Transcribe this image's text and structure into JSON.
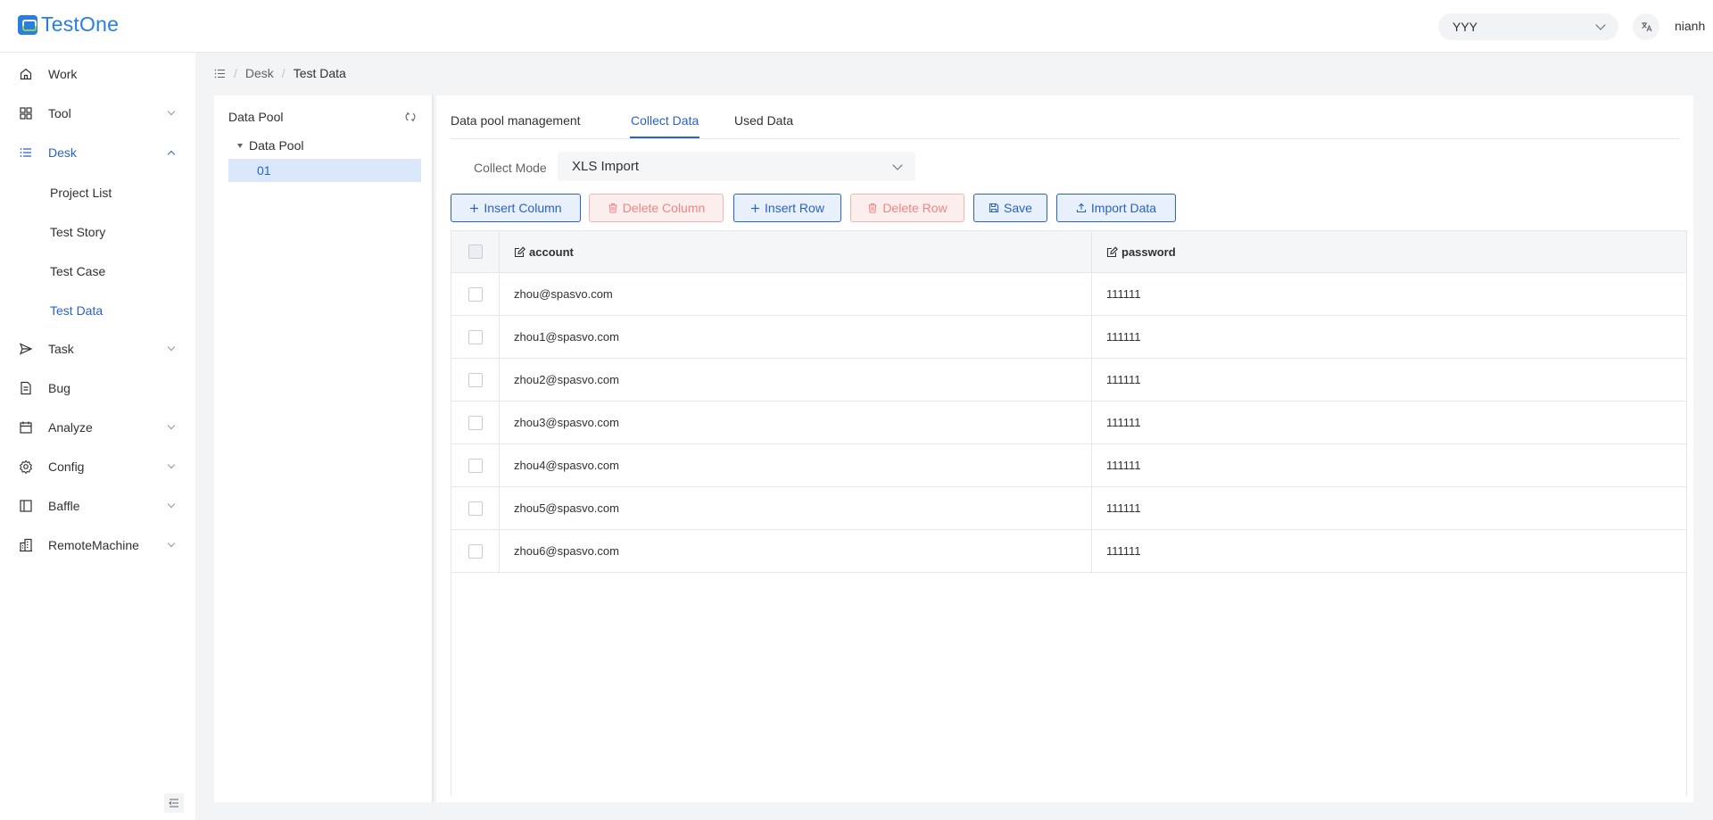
{
  "app": {
    "logo_text": "TestOne"
  },
  "header": {
    "project": "YYY",
    "lang_icon": "translate-icon",
    "user": "nianh"
  },
  "sidebar": {
    "items": [
      {
        "label": "Work",
        "icon": "home-icon"
      },
      {
        "label": "Tool",
        "icon": "grid-icon"
      },
      {
        "label": "Desk",
        "icon": "list-icon"
      },
      {
        "label": "Task",
        "icon": "send-icon"
      },
      {
        "label": "Bug",
        "icon": "document-icon"
      },
      {
        "label": "Analyze",
        "icon": "calendar-icon"
      },
      {
        "label": "Config",
        "icon": "gear-icon"
      },
      {
        "label": "Baffle",
        "icon": "panel-icon"
      },
      {
        "label": "RemoteMachine",
        "icon": "building-icon"
      }
    ],
    "desk_sub": [
      "Project List",
      "Test Story",
      "Test Case",
      "Test Data"
    ]
  },
  "breadcrumb": {
    "root": "Desk",
    "current": "Test Data"
  },
  "tree": {
    "title": "Data Pool",
    "node": "Data Pool",
    "child": "01"
  },
  "tabs": [
    "Data pool management",
    "Collect Data",
    "Used Data"
  ],
  "collect": {
    "label": "Collect Mode",
    "value": "XLS Import"
  },
  "toolbar": {
    "insert_column": "Insert Column",
    "delete_column": "Delete Column",
    "insert_row": "Insert Row",
    "delete_row": "Delete Row",
    "save": "Save",
    "import_data": "Import Data"
  },
  "table": {
    "columns": [
      "account",
      "password"
    ],
    "rows": [
      [
        "zhou@spasvo.com",
        "111111"
      ],
      [
        "zhou1@spasvo.com",
        "111111"
      ],
      [
        "zhou2@spasvo.com",
        "111111"
      ],
      [
        "zhou3@spasvo.com",
        "111111"
      ],
      [
        "zhou4@spasvo.com",
        "111111"
      ],
      [
        "zhou5@spasvo.com",
        "111111"
      ],
      [
        "zhou6@spasvo.com",
        "111111"
      ]
    ]
  },
  "colors": {
    "accent": "#2a62c9",
    "danger": "#f08585"
  }
}
